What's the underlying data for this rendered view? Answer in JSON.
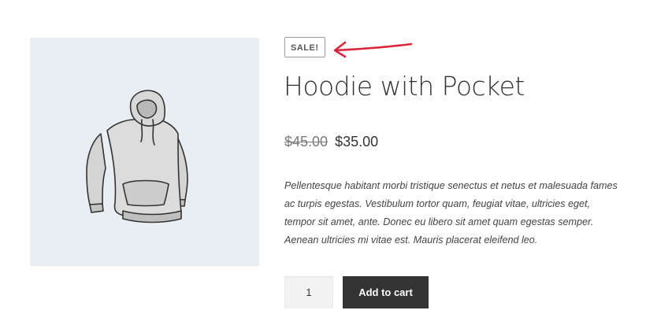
{
  "product": {
    "image_alt": "hoodie-illustration",
    "sale_badge": "SALE!",
    "title": "Hoodie with Pocket",
    "price": {
      "regular": "$45.00",
      "sale": "$35.00"
    },
    "description": "Pellentesque habitant morbi tristique senectus et netus et malesuada fames ac turpis egestas. Vestibulum tortor quam, feugiat vitae, ultricies eget, tempor sit amet, ante. Donec eu libero sit amet quam egestas semper. Aenean ultricies mi vitae est. Mauris placerat eleifend leo.",
    "quantity": "1",
    "add_to_cart_label": "Add to cart"
  },
  "colors": {
    "image_background": "#e8eef2",
    "button_background": "#333333",
    "annotation_arrow": "#d9263b"
  },
  "icons": {
    "annotation": "arrow-left-icon",
    "product": "hoodie-icon"
  }
}
